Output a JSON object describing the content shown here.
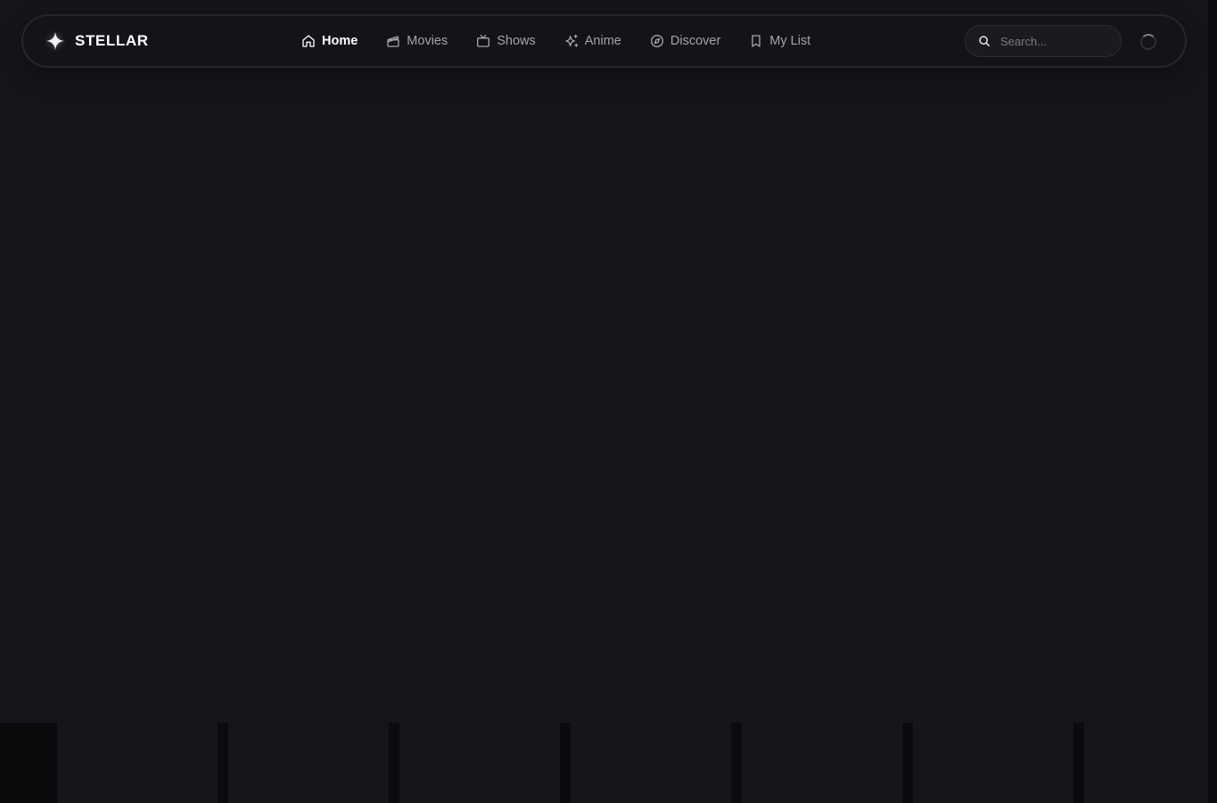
{
  "brand": {
    "name": "STELLAR",
    "icon": "sparkle-icon"
  },
  "nav": {
    "items": [
      {
        "label": "Home",
        "icon": "home-icon",
        "active": true
      },
      {
        "label": "Movies",
        "icon": "clapperboard-icon",
        "active": false
      },
      {
        "label": "Shows",
        "icon": "tv-icon",
        "active": false
      },
      {
        "label": "Anime",
        "icon": "sparkles-icon",
        "active": false
      },
      {
        "label": "Discover",
        "icon": "compass-icon",
        "active": false
      },
      {
        "label": "My List",
        "icon": "bookmark-icon",
        "active": false
      }
    ]
  },
  "search": {
    "placeholder": "Search...",
    "value": "",
    "icon": "search-icon"
  },
  "status": {
    "loading": true,
    "icon": "spinner-icon"
  },
  "colors": {
    "background": "#15161b",
    "navbar_background": "#131419",
    "navbar_border": "#26272c",
    "active_text": "#ffffff",
    "inactive_text": "#a3a4ab"
  }
}
